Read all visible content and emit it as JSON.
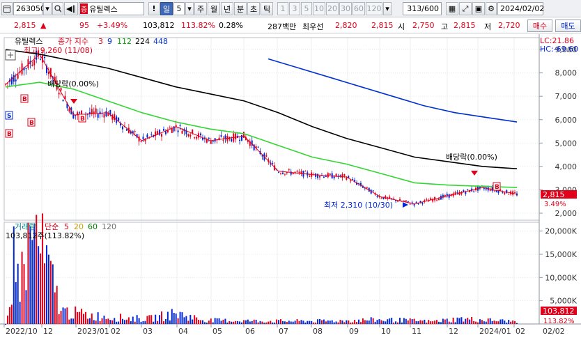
{
  "toolbar": {
    "code": "263050",
    "name": "유틸렉스",
    "period_selected": "일",
    "period_count": "5",
    "periods": [
      "주",
      "월",
      "년",
      "분",
      "초",
      "틱"
    ],
    "intervals": [
      "1",
      "3",
      "5",
      "10",
      "20",
      "30",
      "60",
      "120"
    ],
    "page_counter": "313/600",
    "date": "2024/02/02",
    "name_prefix": "증"
  },
  "quote": {
    "price": "2,815",
    "change": "95",
    "change_pct": "+3.49%",
    "volume": "103,812",
    "volume_ratio": "113.82%",
    "turnover": "0.28%",
    "amount": "287백만",
    "priority_label": "최우선",
    "best_ask": "2,820",
    "best_bid": "2,815",
    "open_label": "시",
    "open": "2,750",
    "high_label": "고",
    "high": "2,815",
    "low_label": "저",
    "low": "2,720",
    "buy_label": "매수",
    "sell_label": "매도"
  },
  "price_panel": {
    "title": "유틸렉스",
    "ma_label": "종가 지수",
    "ma_periods": [
      "3",
      "9",
      "112",
      "224",
      "448"
    ],
    "ma_colors": [
      "#e0001a",
      "#0026d6",
      "#00c800",
      "#000000",
      "#0030d0"
    ],
    "lc": "LC:21.86",
    "hc": "HC:-69.60",
    "high_annotation": "최고 9,260 (11/08)",
    "low_annotation": "최저 2,310 (10/30)",
    "dividend_label_1": "배당락(0.00%)",
    "dividend_label_2": "배당락(0.00%)",
    "last_price": "2,815",
    "last_change": "3.49%",
    "y_ticks": [
      "9,000",
      "8,000",
      "7,000",
      "6,000",
      "5,000",
      "4,000",
      "3,000",
      "2,000"
    ]
  },
  "volume_panel": {
    "title": "거래량",
    "ma_label": "단순",
    "ma_periods": [
      "5",
      "20",
      "60",
      "120"
    ],
    "ma_colors": [
      "#e0001a",
      "#c8a000",
      "#008000",
      "#707070"
    ],
    "last_annotation": "103,812주(113.82%)",
    "last_volume": "103,812",
    "last_ratio": "113.82%",
    "y_ticks": [
      "20,000K",
      "15,000K",
      "10,000K",
      "5,000K"
    ]
  },
  "x_axis": {
    "labels": [
      "2022/10",
      "12",
      "2023/01",
      "02",
      "03",
      "04",
      "05",
      "06",
      "07",
      "08",
      "09",
      "10",
      "11",
      "12",
      "2024/01",
      "02"
    ],
    "right_label": "02/02"
  },
  "chart_data": {
    "type": "line",
    "title": "유틸렉스",
    "x": [
      "2022/10",
      "12",
      "2023/01",
      "02",
      "03",
      "04",
      "05",
      "06",
      "07",
      "08",
      "09",
      "10",
      "11",
      "12",
      "2024/01",
      "02"
    ],
    "series": [
      {
        "name": "3",
        "values": [
          7500,
          8800,
          6200,
          6300,
          5100,
          5700,
          5100,
          5300,
          3800,
          3650,
          3550,
          2700,
          2400,
          2750,
          3100,
          2815
        ]
      },
      {
        "name": "112",
        "values": [
          7400,
          7600,
          7300,
          6800,
          6300,
          5900,
          5600,
          5400,
          4900,
          4400,
          4100,
          3700,
          3300,
          3200,
          3150,
          3100
        ]
      },
      {
        "name": "224",
        "values": [
          9000,
          8800,
          8500,
          8200,
          7800,
          7400,
          7100,
          6800,
          6300,
          5700,
          5200,
          4800,
          4400,
          4200,
          4000,
          3900
        ]
      },
      {
        "name": "448",
        "values": [
          null,
          null,
          null,
          null,
          null,
          null,
          null,
          8600,
          8200,
          7800,
          7400,
          7000,
          6600,
          6300,
          6100,
          5900
        ]
      }
    ],
    "volume": [
      0,
      22000,
      3000,
      2000,
      1500,
      1200,
      2500,
      900,
      800,
      700,
      700,
      700,
      800,
      1000,
      900,
      600,
      1200,
      900,
      600
    ],
    "ylim": [
      2000,
      9300
    ],
    "volume_ylim": [
      0,
      21000
    ],
    "annotations": [
      "최고 9,260 (11/08)",
      "최저 2,310 (10/30)"
    ]
  }
}
